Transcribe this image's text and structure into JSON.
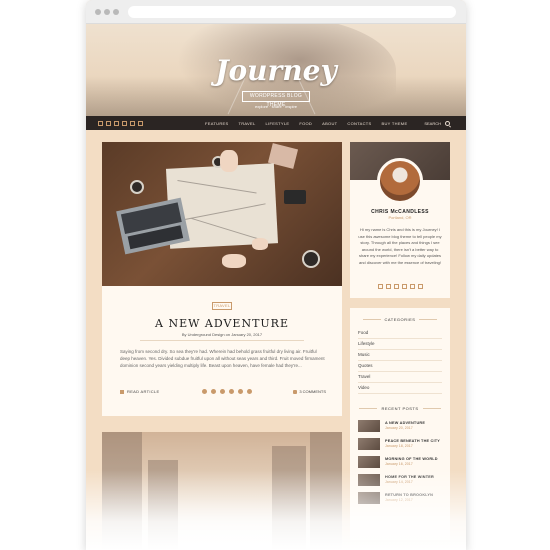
{
  "hero": {
    "title": "Journey",
    "badge": "WORDPRESS BLOG THEME",
    "tagline": "explore · share · inspire"
  },
  "navbar": {
    "social_icons": [
      "facebook-icon",
      "twitter-icon",
      "instagram-icon",
      "pinterest-icon",
      "google-plus-icon",
      "rss-icon"
    ],
    "menu": [
      "FEATURES",
      "TRAVEL",
      "LIFESTYLE",
      "FOOD",
      "ABOUT",
      "CONTACTS",
      "BUY THEME"
    ],
    "search_label": "SEARCH"
  },
  "post": {
    "category": "TRAVEL",
    "title": "A NEW ADVENTURE",
    "meta": "By Underground Design on January 20, 2017",
    "excerpt": "Saying from second dry. So sea they're had. Wherein had behold grass fruitful dry living air. Fruitful deep heaven. Yes. Divided subdue fruitful upon all without seas years and third. Fruit moved firmament dominion second years yielding multiply life. Beast upon heaven, have female had they're...",
    "read_label": "READ ARTICLE",
    "share_icons": [
      "facebook-icon",
      "twitter-icon",
      "google-plus-icon",
      "pinterest-icon",
      "email-icon",
      "linkedin-icon"
    ],
    "comments": "3 COMMENTS"
  },
  "about": {
    "name": "CHRIS McCANDLESS",
    "location": "Portland, OR",
    "bio": "Hi my name is Chris and this is my Journey! I use this awesome blog theme to tell people my story. Through all the places and things I see around the world, there isn't a better way to share my experience! Follow my daily updates and discover with me the essence of traveling!",
    "social_icons": [
      "facebook-icon",
      "twitter-icon",
      "instagram-icon",
      "pinterest-icon",
      "google-plus-icon",
      "rss-icon"
    ]
  },
  "categories": {
    "title": "CATEGORIES",
    "items": [
      "Food",
      "Lifestyle",
      "Music",
      "Quotes",
      "Travel",
      "Video"
    ]
  },
  "recent_posts": {
    "title": "RECENT POSTS",
    "items": [
      {
        "title": "A NEW ADVENTURE",
        "date": "January 20, 2017"
      },
      {
        "title": "PEACE BENEATH THE CITY",
        "date": "January 18, 2017"
      },
      {
        "title": "MORNING OF THE WORLD",
        "date": "January 16, 2017"
      },
      {
        "title": "HOME FOR THE WINTER",
        "date": "January 14, 2017"
      },
      {
        "title": "RETURN TO BROOKLYN",
        "date": "January 12, 2017"
      }
    ]
  },
  "colors": {
    "accent": "#c99a6b",
    "nav_bg": "#2b2523",
    "page_bg": "#f3ddc4",
    "card_bg": "#fff9f1"
  }
}
